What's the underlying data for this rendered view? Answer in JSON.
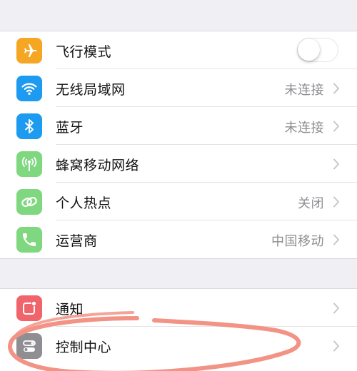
{
  "colors": {
    "background": "#efeff4",
    "cell": "#ffffff",
    "label_text": "#111111",
    "value_text": "#8e8e93",
    "chevron": "#c7c7cc",
    "annotation_circle": "#f29386"
  },
  "settings_group_1": {
    "airplane": {
      "label": "飞行模式",
      "icon": "airplane-icon",
      "icon_color": "#f5a623",
      "toggle_on": false
    },
    "wifi": {
      "label": "无线局域网",
      "value": "未连接",
      "icon": "wifi-icon",
      "icon_color": "#1d9bf0"
    },
    "bluetooth": {
      "label": "蓝牙",
      "value": "未连接",
      "icon": "bluetooth-icon",
      "icon_color": "#1d9bf0"
    },
    "cellular": {
      "label": "蜂窝移动网络",
      "icon": "cellular-antenna-icon",
      "icon_color": "#7fd77f"
    },
    "hotspot": {
      "label": "个人热点",
      "value": "关闭",
      "icon": "hotspot-link-icon",
      "icon_color": "#7fd77f"
    },
    "carrier": {
      "label": "运营商",
      "value": "中国移动",
      "icon": "phone-icon",
      "icon_color": "#7fd77f"
    }
  },
  "settings_group_2": {
    "notifications": {
      "label": "通知",
      "icon": "notifications-icon",
      "icon_color": "#f0646c"
    },
    "control_center": {
      "label": "控制中心",
      "icon": "control-center-toggles-icon",
      "icon_color": "#8e8e93"
    }
  }
}
